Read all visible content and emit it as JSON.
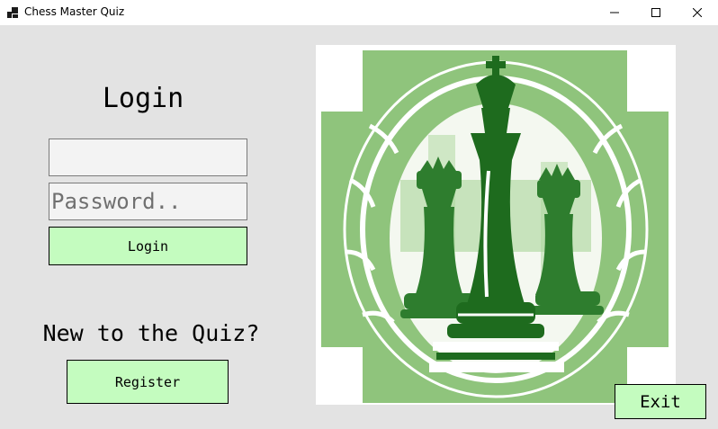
{
  "window": {
    "title": "Chess Master Quiz",
    "controls": {
      "minimize": "—",
      "maximize": "☐",
      "close": "✕"
    }
  },
  "login": {
    "heading": "Login",
    "username_value": "",
    "password_placeholder": "Password..",
    "button_label": "Login"
  },
  "register": {
    "prompt": "New to the Quiz?",
    "button_label": "Register"
  },
  "exit_button_label": "Exit",
  "image": {
    "subject": "chess-pieces-illustration"
  },
  "colors": {
    "button_fill": "#c4fcbf",
    "background": "#e3e3e3",
    "art_light_green": "#8fc47c",
    "art_dark_green": "#1e6b1e"
  }
}
